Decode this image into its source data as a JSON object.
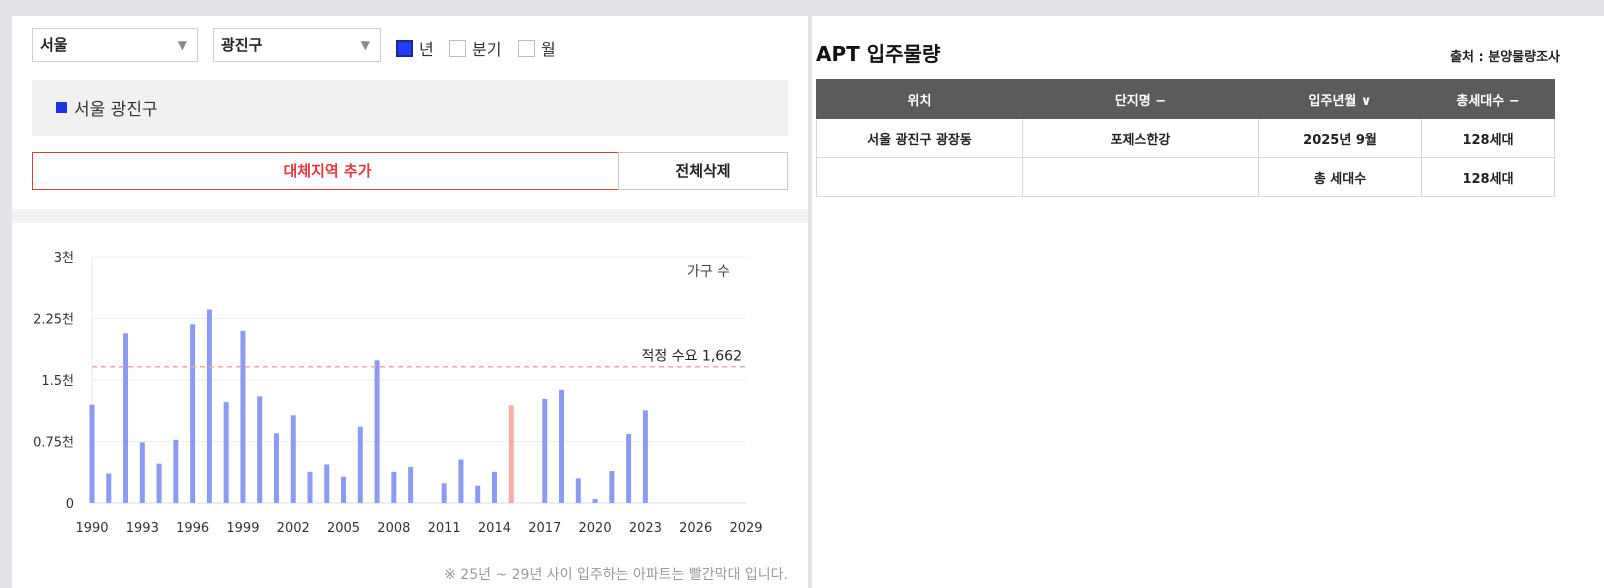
{
  "filters": {
    "city": "서울",
    "district": "광진구",
    "periods": [
      {
        "label": "년",
        "checked": true
      },
      {
        "label": "분기",
        "checked": false
      },
      {
        "label": "월",
        "checked": false
      }
    ]
  },
  "selected_region": "서울 광진구",
  "buttons": {
    "add_region": "대체지역 추가",
    "clear_all": "전체삭제"
  },
  "chart_note": "※ 25년 ~ 29년 사이 입주하는 아파트는 빨간막대 입니다.",
  "colors": {
    "bar": "#8c9af3",
    "future_bar": "#f6aea6",
    "reference_line": "#f4a6a6",
    "accent_blue": "#1f3cff",
    "accent_red": "#e03a3a"
  },
  "chart_data": {
    "type": "bar",
    "x_start": 1990,
    "x_end": 2029,
    "x_ticks": [
      "1990",
      "1993",
      "1996",
      "1999",
      "2002",
      "2005",
      "2008",
      "2011",
      "2014",
      "2017",
      "2020",
      "2023",
      "2026",
      "2029"
    ],
    "y_ticks": [
      "0",
      "0.75천",
      "1.5천",
      "2.25천",
      "3천"
    ],
    "ylim": [
      0,
      3000
    ],
    "unit_label": "가구 수",
    "reference_line": {
      "value": 1662,
      "label": "적정 수요 1,662"
    },
    "years": [
      1990,
      1991,
      1992,
      1993,
      1994,
      1995,
      1996,
      1997,
      1998,
      1999,
      2000,
      2001,
      2002,
      2003,
      2004,
      2005,
      2006,
      2007,
      2008,
      2009,
      2010,
      2011,
      2012,
      2013,
      2014,
      2015,
      2016,
      2017,
      2018,
      2019,
      2020,
      2021,
      2022,
      2023,
      2024,
      2025
    ],
    "series": [
      {
        "values": [
          1200,
          360,
          2070,
          740,
          480,
          770,
          2180,
          2360,
          1230,
          2100,
          1300,
          850,
          1070,
          380,
          470,
          320,
          930,
          1740,
          380,
          440,
          0,
          240,
          530,
          210,
          380,
          70,
          0,
          1270,
          1380,
          300,
          50,
          390,
          840,
          1130,
          0,
          0
        ]
      },
      {
        "name": "25년 ~ 29년",
        "values": [
          0,
          0,
          0,
          0,
          0,
          0,
          0,
          0,
          0,
          0,
          0,
          0,
          0,
          0,
          0,
          0,
          0,
          0,
          0,
          0,
          0,
          0,
          0,
          0,
          0,
          1190,
          0,
          0,
          0,
          0,
          0,
          0,
          0,
          0,
          0,
          0
        ]
      }
    ]
  },
  "right": {
    "title": "APT 입주물량",
    "source": "출처 : 분양물량조사",
    "headers": [
      "위치",
      "단지명 −",
      "입주년월 ∨",
      "총세대수 −"
    ],
    "rows": [
      [
        "서울 광진구 광장동",
        "포제스한강",
        "2025년 9월",
        "128세대"
      ],
      [
        "",
        "",
        "총 세대수",
        "128세대"
      ]
    ]
  }
}
